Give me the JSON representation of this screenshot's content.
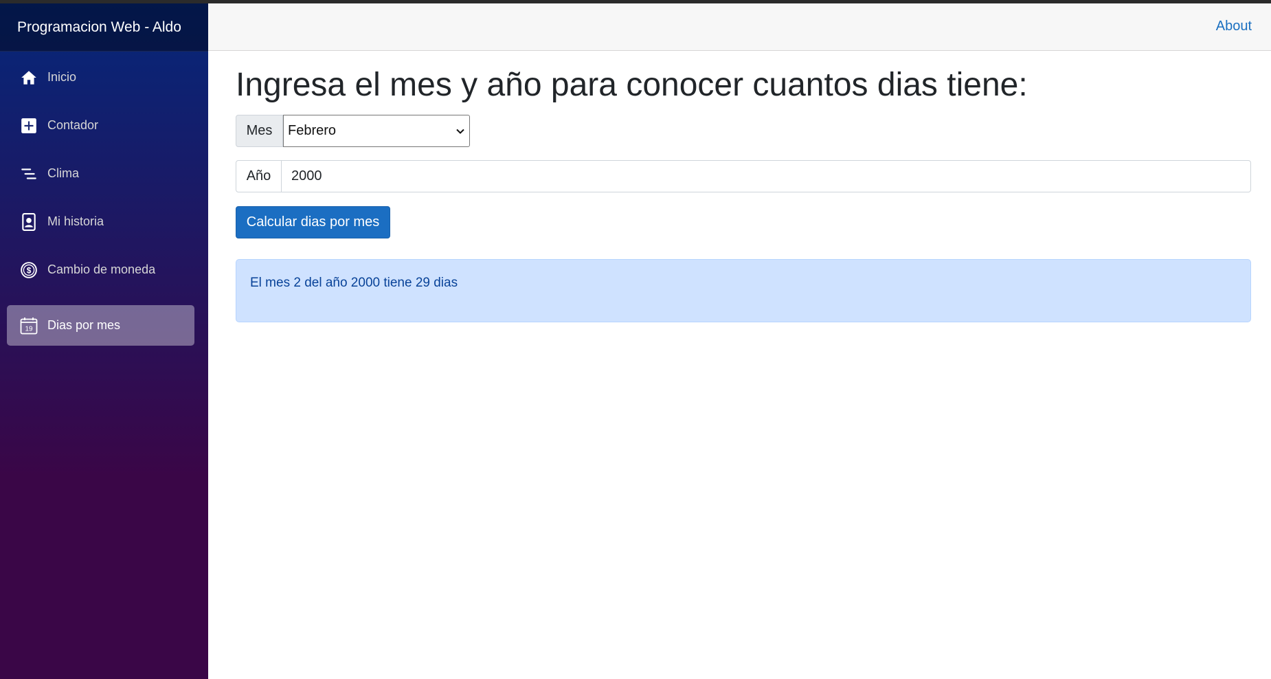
{
  "app": {
    "brand": "Programacion Web - Aldo"
  },
  "sidebar": {
    "items": [
      {
        "label": "Inicio",
        "icon": "home-icon"
      },
      {
        "label": "Contador",
        "icon": "plus-square-icon"
      },
      {
        "label": "Clima",
        "icon": "list-lines-icon"
      },
      {
        "label": "Mi historia",
        "icon": "person-badge-icon"
      },
      {
        "label": "Cambio de moneda",
        "icon": "dollar-circle-icon"
      },
      {
        "label": "Dias por mes",
        "icon": "calendar-icon",
        "active": true
      }
    ],
    "calendar_day": "19"
  },
  "topbar": {
    "about_label": "About"
  },
  "main": {
    "title": "Ingresa el mes y año para conocer cuantos dias tiene:",
    "mes_label": "Mes",
    "mes_selected": "Febrero",
    "ano_label": "Año",
    "ano_value": "2000",
    "button_label": "Calcular dias por mes",
    "result_text": "El mes 2 del año 2000 tiene 29 dias"
  },
  "colors": {
    "sidebar_top": "#05277a",
    "sidebar_bottom": "#3a0647",
    "primary": "#1b6ec2",
    "alert_bg": "#cfe2ff",
    "link": "#1a6fc0"
  }
}
